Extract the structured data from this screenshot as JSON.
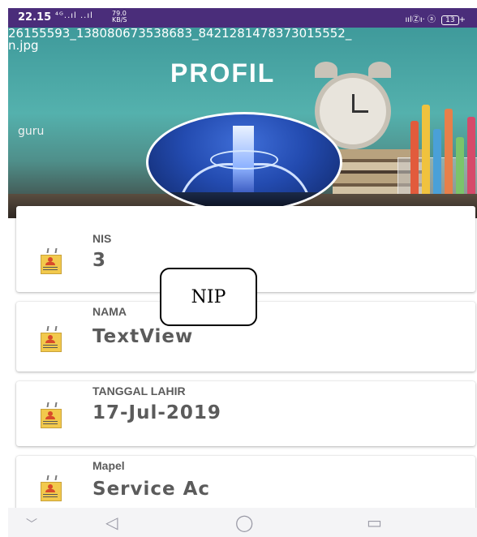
{
  "status_bar": {
    "time": "22.15",
    "signal": "⁴ᴳ..ıl ..ıl",
    "net_speed_value": "79.0",
    "net_speed_unit": "KB/S",
    "right_icons": "ıılⓏı· ⓐ",
    "battery": "13"
  },
  "header": {
    "file_name_line1": "26155593_138080673538683_8421281478373015552_",
    "file_name_line2": "n.jpg",
    "title": "PROFIL",
    "role": "guru"
  },
  "fields": [
    {
      "label": "NIS",
      "value": "3",
      "icon": "id-badge-icon"
    },
    {
      "label": "NAMA",
      "value": "TextView",
      "icon": "id-badge-icon"
    },
    {
      "label": "TANGGAL LAHIR",
      "value": "17-Jul-2019",
      "icon": "id-badge-icon"
    },
    {
      "label": "Mapel",
      "value": "Service Ac",
      "icon": "id-badge-icon"
    }
  ],
  "callout": {
    "text": "NIP"
  },
  "nav": {
    "collapse": "﹀",
    "back": "◁",
    "home": "◯",
    "recents": "▭"
  }
}
